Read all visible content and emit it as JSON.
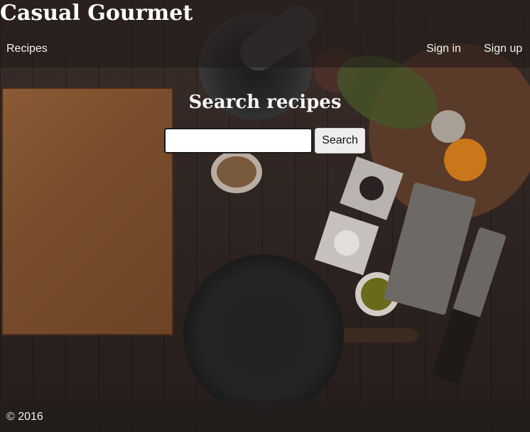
{
  "header": {
    "brand": "Casual Gourmet",
    "nav": {
      "recipes": "Recipes",
      "sign_in": "Sign in",
      "sign_up": "Sign up"
    }
  },
  "search": {
    "title": "Search recipes",
    "input_value": "",
    "input_placeholder": "",
    "button_label": "Search"
  },
  "footer": {
    "copyright": "© 2016"
  },
  "colors": {
    "header_text": "#ffffff",
    "button_bg": "#eeeeee",
    "background_wood": "#2e2421"
  }
}
